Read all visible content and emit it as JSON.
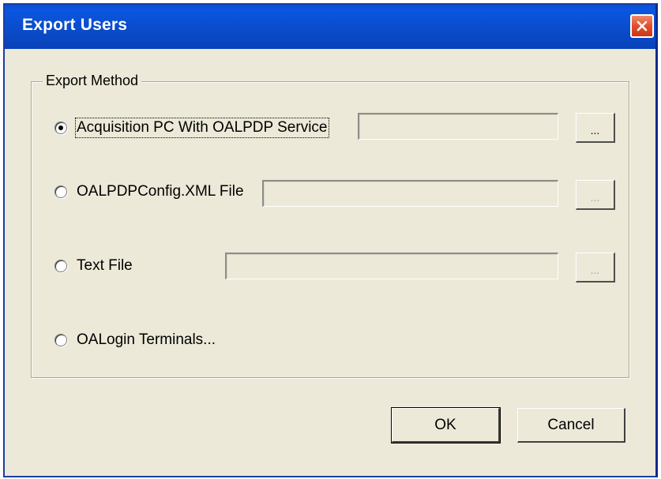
{
  "window": {
    "title": "Export Users"
  },
  "export_method": {
    "legend": "Export Method",
    "options": [
      {
        "label": "Acquisition PC With OALPDP Service",
        "selected": true,
        "has_path": true,
        "browse_label": "...",
        "browse_enabled": true
      },
      {
        "label": "OALPDPConfig.XML File",
        "selected": false,
        "has_path": true,
        "browse_label": "...",
        "browse_enabled": false
      },
      {
        "label": "Text File",
        "selected": false,
        "has_path": true,
        "browse_label": "...",
        "browse_enabled": false
      },
      {
        "label": "OALogin Terminals...",
        "selected": false,
        "has_path": false
      }
    ]
  },
  "buttons": {
    "ok_label": "OK",
    "cancel_label": "Cancel"
  },
  "icons": {
    "close": "close-icon"
  },
  "colors": {
    "titlebar": "#0a4ccb",
    "dialog_bg": "#ece9d8",
    "close_button": "#e0502c"
  }
}
